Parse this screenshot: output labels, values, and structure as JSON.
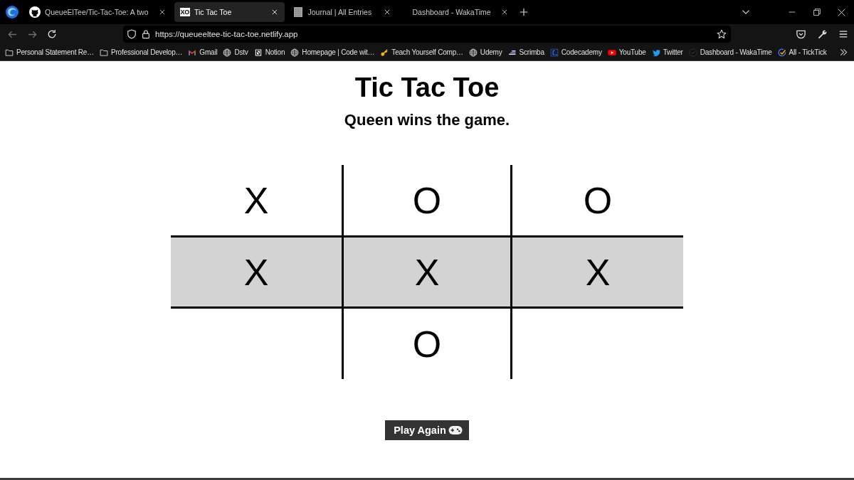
{
  "tabs": [
    {
      "title": "QueueElTee/Tic-Tac-Toe: A two",
      "kind": "github",
      "selected": false
    },
    {
      "title": "Tic Tac Toe",
      "kind": "text",
      "favicon_text": "XO",
      "selected": true
    },
    {
      "title": "Journal | All Entries",
      "kind": "notebook",
      "selected": false
    },
    {
      "title": "Dashboard - WakaTime",
      "selected": false
    }
  ],
  "toolbar": {
    "back": {
      "disabled": true
    },
    "forward": {
      "disabled": true
    },
    "address": {
      "value": "https://queueeltee-tic-tac-toe.netlify.app"
    }
  },
  "bookmarks": [
    {
      "label": "Personal Statement Re…",
      "kind": "folder"
    },
    {
      "label": "Professional Develop…",
      "kind": "folder"
    },
    {
      "label": "Gmail",
      "kind": "mail"
    },
    {
      "label": "Dstv",
      "kind": "globe"
    },
    {
      "label": "Notion",
      "kind": "notion"
    },
    {
      "label": "Homepage | Code wit…",
      "kind": "globe"
    },
    {
      "label": "Teach Yourself Comp…",
      "kind": "key"
    },
    {
      "label": "Udemy",
      "kind": "globe"
    },
    {
      "label": "Scrimba",
      "kind": "scrimba"
    },
    {
      "label": "Codecademy",
      "kind": "codecademy"
    },
    {
      "label": "YouTube",
      "kind": "youtube"
    },
    {
      "label": "Twitter",
      "kind": "twitter"
    },
    {
      "label": "Dashboard - WakaTime",
      "kind": "wakatime"
    },
    {
      "label": "All - TickTick",
      "kind": "ticktick"
    }
  ],
  "page": {
    "title": "Tic Tac Toe",
    "status": "Queen wins the game.",
    "board": {
      "rows": [
        {
          "winning": false,
          "cells": [
            {
              "mark": "X"
            },
            {
              "mark": "O"
            },
            {
              "mark": "O"
            }
          ]
        },
        {
          "winning": true,
          "cells": [
            {
              "mark": "X"
            },
            {
              "mark": "X"
            },
            {
              "mark": "X"
            }
          ]
        },
        {
          "winning": false,
          "cells": [
            {},
            {
              "mark": "O"
            },
            {}
          ]
        }
      ]
    },
    "button": {
      "label": "Play Again"
    }
  }
}
